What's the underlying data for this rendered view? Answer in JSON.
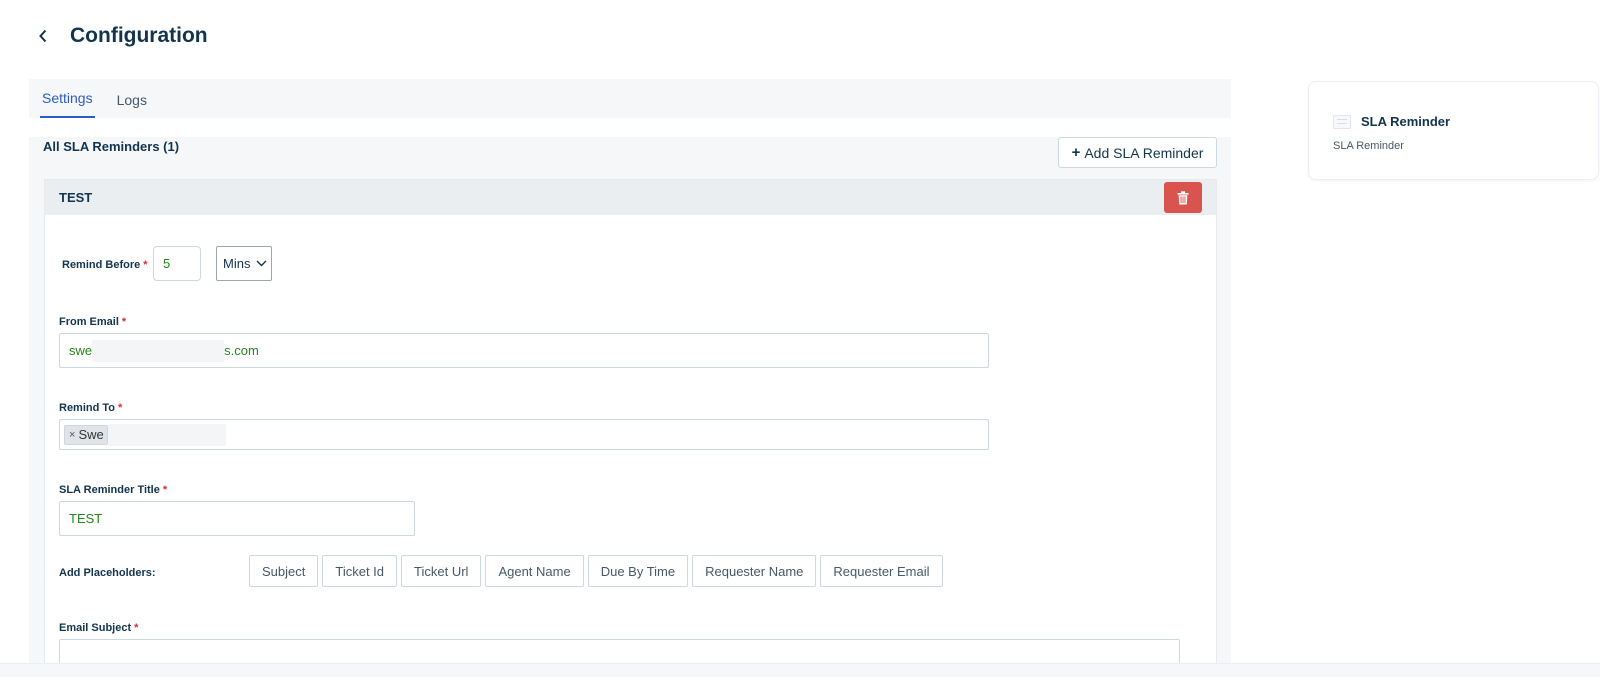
{
  "header": {
    "title": "Configuration",
    "back_icon": "chevron-left-icon"
  },
  "tabs": [
    {
      "label": "Settings",
      "active": true
    },
    {
      "label": "Logs",
      "active": false
    }
  ],
  "list": {
    "title": "All SLA Reminders (1)",
    "add_button_label": "Add SLA Reminder",
    "add_icon": "plus-icon"
  },
  "reminder": {
    "name": "TEST",
    "delete_icon": "trash-icon",
    "delete_color": "#d9534f",
    "remind_before": {
      "label": "Remind Before",
      "value": "5",
      "unit": "Mins"
    },
    "from_email": {
      "label": "From Email",
      "value_start": "swe",
      "value_end": "s.com"
    },
    "remind_to": {
      "label": "Remind To",
      "tags": [
        {
          "text": "Swe"
        }
      ]
    },
    "title_field": {
      "label": "SLA Reminder Title",
      "value": "TEST"
    },
    "placeholders": {
      "label": "Add Placeholders:",
      "buttons": [
        "Subject",
        "Ticket Id",
        "Ticket Url",
        "Agent Name",
        "Due By Time",
        "Requester Name",
        "Requester Email"
      ]
    },
    "email_subject": {
      "label": "Email Subject"
    }
  },
  "side": {
    "title": "SLA Reminder",
    "subtitle": "SLA Reminder",
    "icon": "list-icon"
  },
  "colors": {
    "accent": "#2c5cc5",
    "value_text": "#27831f",
    "required": "#d72d30"
  }
}
